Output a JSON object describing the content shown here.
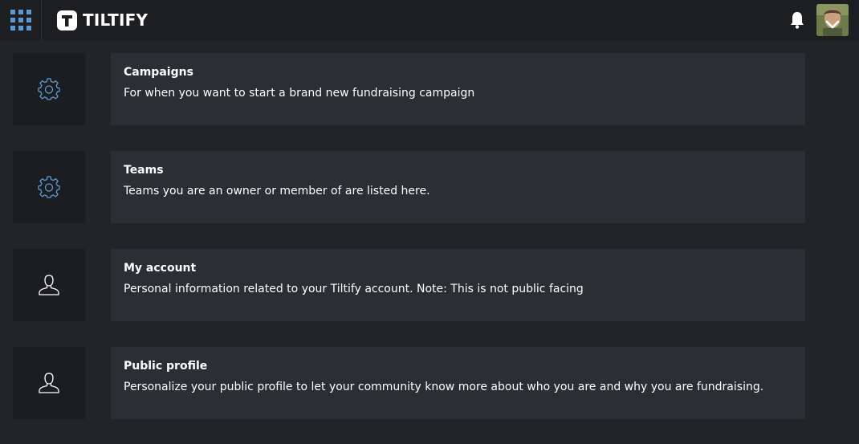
{
  "header": {
    "apps_icon": "grid-apps-icon",
    "logo_icon": "tiltify-logo-icon",
    "logo_text": "TILTIFY",
    "notifications_icon": "bell-icon",
    "avatar_icon": "user-avatar",
    "avatar_menu_icon": "chevron-down-icon",
    "accent_color": "#5b9bd5"
  },
  "menu": [
    {
      "icon": "gear-icon",
      "title": "Campaigns",
      "description": "For when you want to start a brand new fundraising campaign"
    },
    {
      "icon": "gear-icon",
      "title": "Teams",
      "description": "Teams you are an owner or member of are listed here."
    },
    {
      "icon": "user-icon",
      "title": "My account",
      "description": "Personal information related to your Tiltify account. Note: This is not public facing"
    },
    {
      "icon": "user-icon",
      "title": "Public profile",
      "description": "Personalize your public profile to let your community know more about who you are and why you are fundraising."
    }
  ]
}
